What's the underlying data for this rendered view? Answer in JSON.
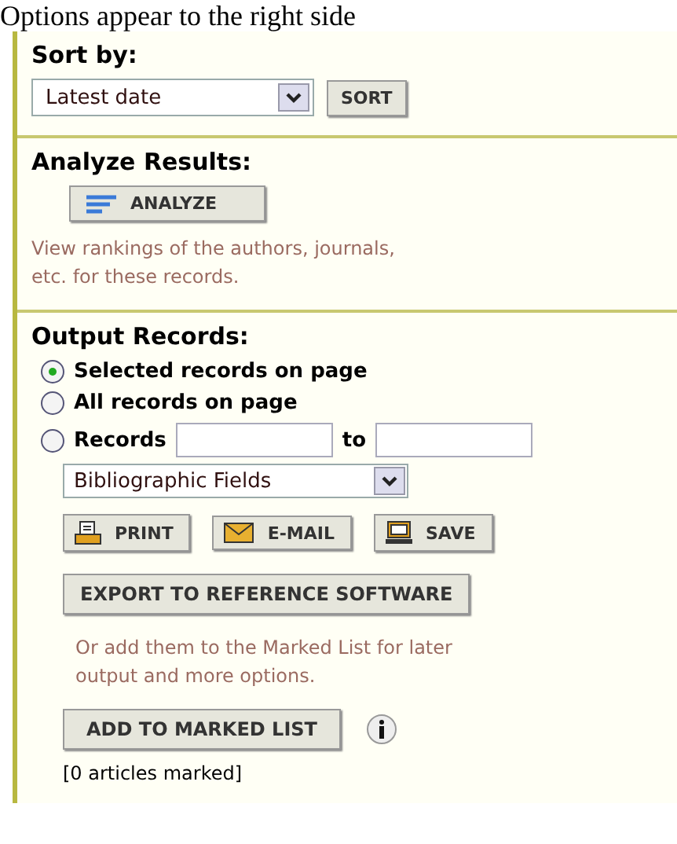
{
  "intro": "Options appear to the right side",
  "sort": {
    "heading": "Sort by:",
    "select": "Latest date",
    "button": "SORT"
  },
  "analyze": {
    "heading": "Analyze Results:",
    "button": "ANALYZE",
    "note": "View rankings of the authors, journals, etc. for these records."
  },
  "output": {
    "heading": "Output Records:",
    "options": [
      {
        "kind": "plain",
        "label": "Selected records on page",
        "selected": true
      },
      {
        "kind": "plain",
        "label": "All records on page",
        "selected": false
      },
      {
        "kind": "range",
        "label": "Records",
        "between": "to",
        "selected": false
      }
    ],
    "fields_select": "Bibliographic Fields",
    "buttons": [
      {
        "kind": "print",
        "label": "PRINT"
      },
      {
        "kind": "email",
        "label": "E-MAIL"
      },
      {
        "kind": "save",
        "label": "SAVE"
      }
    ],
    "export_button": "EXPORT TO REFERENCE SOFTWARE",
    "note": "Or add them to the Marked List for later output and more options.",
    "mark_button": "ADD TO MARKED LIST",
    "count": "[0 articles marked]"
  }
}
